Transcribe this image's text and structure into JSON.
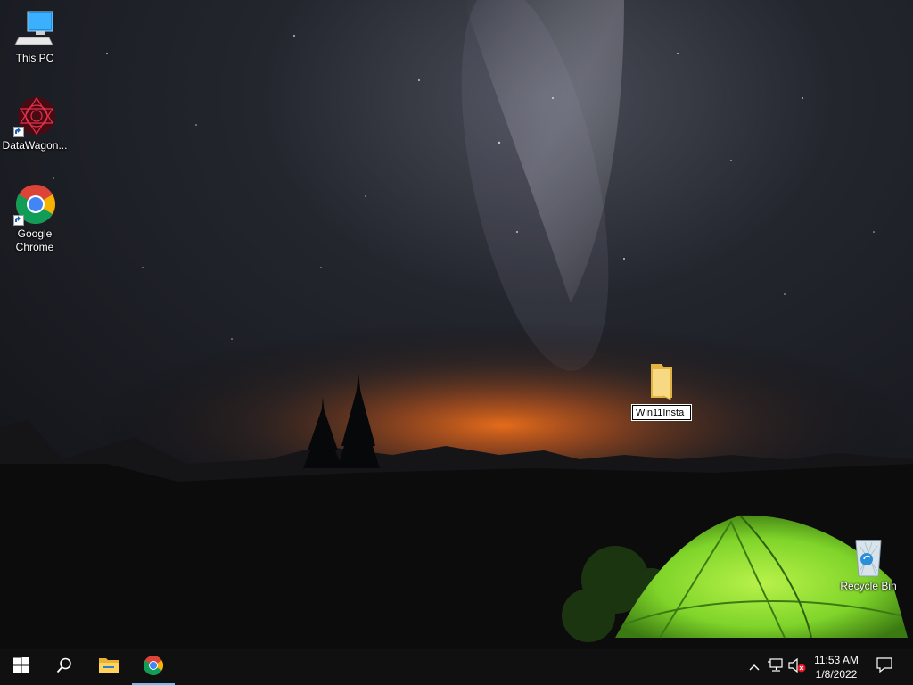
{
  "desktop": {
    "icons": [
      {
        "label": "This PC",
        "icon": "computer-icon"
      },
      {
        "label": "DataWagon...",
        "icon": "datawagon-icon"
      },
      {
        "label": "Google Chrome",
        "icon": "chrome-icon"
      },
      {
        "label": "Recycle Bin",
        "icon": "recycle-bin-icon"
      }
    ],
    "rename_folder": {
      "icon": "folder-icon",
      "value": "Win11Insta"
    }
  },
  "taskbar": {
    "start": {
      "icon": "windows-start-icon"
    },
    "search": {
      "icon": "search-icon"
    },
    "pinned": [
      {
        "name": "File Explorer",
        "icon": "file-explorer-icon"
      },
      {
        "name": "Google Chrome",
        "icon": "chrome-icon",
        "active": true
      }
    ],
    "tray": {
      "icons": [
        "chevron-up-icon",
        "network-icon",
        "volume-muted-icon"
      ],
      "time": "11:53 AM",
      "date": "1/8/2022",
      "notification_icon": "notification-icon"
    }
  },
  "colors": {
    "taskbar_bg": "#101010",
    "accent": "#76b9ed",
    "tent_green": "#7fd42a"
  }
}
